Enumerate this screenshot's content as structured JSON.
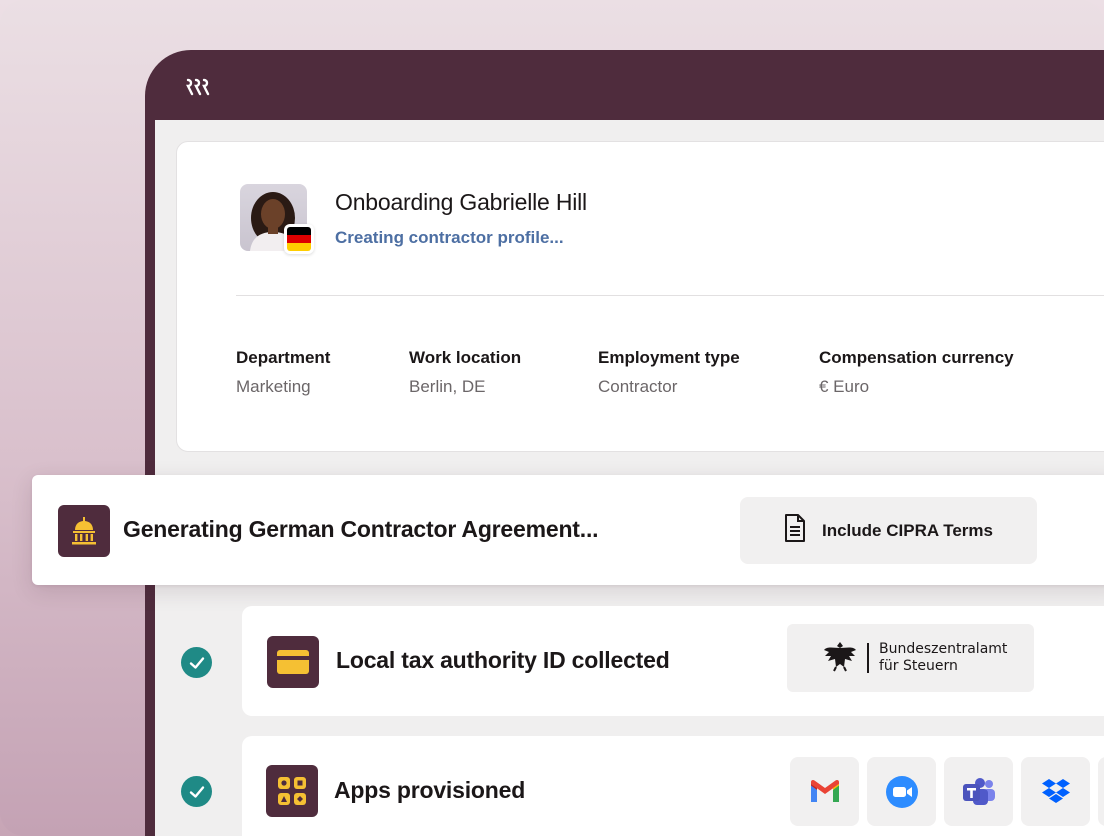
{
  "profile": {
    "title": "Onboarding Gabrielle Hill",
    "subtitle": "Creating contractor profile...",
    "fields": [
      {
        "label": "Department",
        "value": "Marketing"
      },
      {
        "label": "Work location",
        "value": "Berlin, DE"
      },
      {
        "label": "Employment type",
        "value": "Contractor"
      },
      {
        "label": "Compensation currency",
        "value": "€ Euro"
      }
    ]
  },
  "banner": {
    "text": "Generating German Contractor Agreement...",
    "button_label": "Include CIPRA Terms"
  },
  "rows": [
    {
      "text": "Local tax authority ID collected",
      "logo_line1": "Bundeszentralamt",
      "logo_line2": "für Steuern"
    },
    {
      "text": "Apps provisioned"
    }
  ],
  "apps": [
    "gmail-icon",
    "zoom-icon",
    "teams-icon",
    "dropbox-icon"
  ],
  "colors": {
    "brand": "#4f2c3d",
    "accent_blue": "#4d6fa3",
    "check_green": "#1f8a86",
    "icon_yellow": "#f5c033"
  }
}
